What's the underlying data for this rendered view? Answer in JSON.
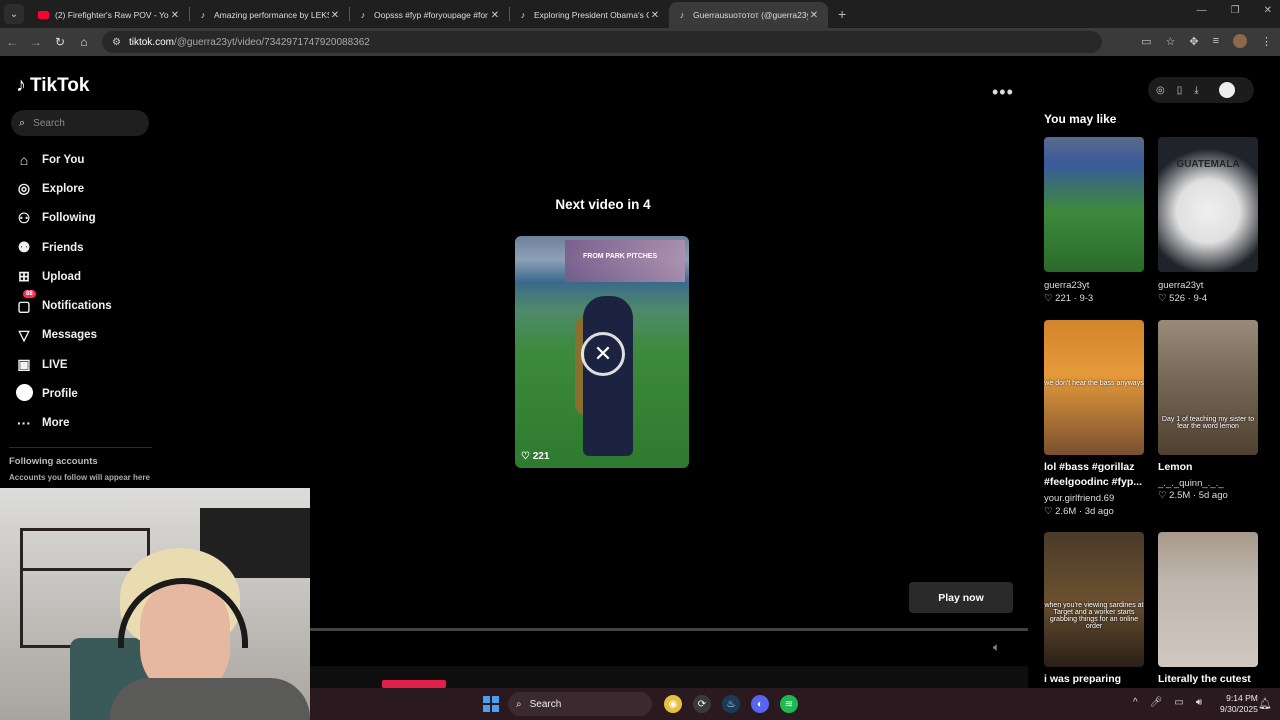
{
  "browser": {
    "tabs": [
      {
        "title": "(2) Firefighter's Raw POV - YouT",
        "favicon": "youtube-icon",
        "active": false
      },
      {
        "title": "Amazing performance by LEKSI",
        "favicon": "tiktok-icon",
        "active": false
      },
      {
        "title": "Oopsss #fyp #foryoupage #for",
        "favicon": "tiktok-icon",
        "active": false
      },
      {
        "title": "Exploring President Obama's C",
        "favicon": "tiktok-icon",
        "active": false
      },
      {
        "title": "Guerrausuoтoтот (@guerra23y",
        "favicon": "tiktok-icon",
        "active": true
      }
    ],
    "address_host": "tiktok.com",
    "address_path": "/@guerra23yt/video/7342971747920088362"
  },
  "sidebar": {
    "logo": "TikTok",
    "search_placeholder": "Search",
    "nav": [
      {
        "label": "For You",
        "icon": "home-icon"
      },
      {
        "label": "Explore",
        "icon": "compass-icon"
      },
      {
        "label": "Following",
        "icon": "following-icon"
      },
      {
        "label": "Friends",
        "icon": "friends-icon"
      },
      {
        "label": "Upload",
        "icon": "upload-icon"
      },
      {
        "label": "Notifications",
        "icon": "inbox-icon",
        "badge": "88"
      },
      {
        "label": "Messages",
        "icon": "send-icon"
      },
      {
        "label": "LIVE",
        "icon": "live-icon"
      },
      {
        "label": "Profile",
        "icon": "avatar-icon"
      },
      {
        "label": "More",
        "icon": "more-icon"
      }
    ],
    "following_heading": "Following accounts",
    "following_sub": "Accounts you follow will appear here"
  },
  "player": {
    "next_title": "Next video in 4",
    "next_likes": "221",
    "thumb_caption": "FROM PARK PITCHES",
    "play_now": "Play now"
  },
  "suggestions": {
    "heading": "You may like",
    "items": [
      {
        "title": "",
        "author": "guerra23yt",
        "stats": "221 · 9-3"
      },
      {
        "title": "",
        "author": "guerra23yt",
        "stats": "526 · 9-4",
        "caption": "GUATEMALA"
      },
      {
        "title": "lol #bass #gorillaz #feelgoodinc #fyp...",
        "author": "your.girlfriend.69",
        "stats": "2.6M · 3d ago",
        "caption": "we don't hear the bass anyways"
      },
      {
        "title": "Lemon",
        "author": "_._._quinn_._._",
        "stats": "2.5M · 5d ago",
        "caption": "Day 1 of teaching my sister to fear the word lemon"
      },
      {
        "title": "i was preparing",
        "caption": "when you're viewing sardines at Target and a worker starts grabbing things for an online order"
      },
      {
        "title": "Literally the cutest"
      }
    ]
  },
  "taskbar": {
    "search_label": "Search",
    "time": "9:14 PM",
    "date": "9/30/2025"
  },
  "colors": {
    "accent": "#fe2c55",
    "windows_blue": "#4aa0f0"
  }
}
